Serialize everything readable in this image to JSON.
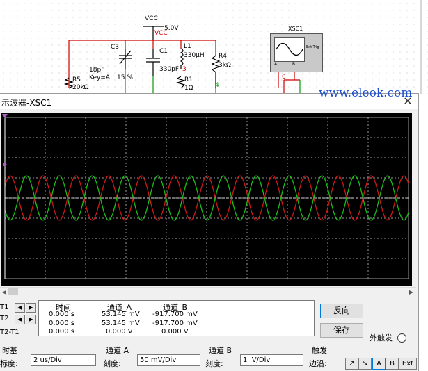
{
  "schematic": {
    "vcc_label": "VCC",
    "vcc_value": "5.0V",
    "vcc_net": "VCC",
    "c3_label": "C3",
    "c3_value": "18pF",
    "c3_key": "Key=A",
    "c3_percent": "15 %",
    "c1_label": "C1",
    "c1_value": "330pF",
    "l1_label": "L1",
    "l1_value": "330µH",
    "node3": "3",
    "r4_label": "R4",
    "r4_value": "3kΩ",
    "r5_label": "R5",
    "r5_value": "20kΩ",
    "r1_label": "R1",
    "r1_value": "1Ω",
    "node4": "4",
    "xsc_label": "XSC1",
    "ext_trig": "Ext Trig",
    "pin_a": "A",
    "pin_b": "B",
    "node0": "0"
  },
  "window": {
    "title": "示波器-XSC1",
    "close_glyph": "✕"
  },
  "cursors": {
    "t1": "T1",
    "t2": "T2",
    "t2t1": "T2-T1",
    "left_arrow": "◀",
    "right_arrow": "▶"
  },
  "readout": {
    "headers": [
      "时间",
      "通道_A",
      "通道_B"
    ],
    "rows": [
      [
        "0.000 s",
        "53.145 mV",
        "-917.700 mV"
      ],
      [
        "0.000 s",
        "53.145 mV",
        "-917.700 mV"
      ],
      [
        "0.000 s",
        "0.000 V",
        "0.000 V"
      ]
    ]
  },
  "buttons": {
    "reverse": "反向",
    "save": "保存",
    "ext_trigger": "外触发"
  },
  "timebase": {
    "section": "时基",
    "scale_label": "标度:",
    "scale_value": "2 us/Div"
  },
  "channel_a": {
    "section": "通道 A",
    "scale_label": "刻度:",
    "scale_value": "50 mV/Div"
  },
  "channel_b": {
    "section": "通道 B",
    "scale_label": "刻度:",
    "scale_value": "1  V/Div"
  },
  "trigger": {
    "section": "触发",
    "edge_label": "边沿:",
    "buttons": [
      "↗",
      "↘",
      "A",
      "B",
      "Ext"
    ]
  },
  "watermark": "www.eleok.com",
  "scope": {
    "grid_cols": 10,
    "grid_rows": 8,
    "red_cycles": 12.3,
    "green_cycles": 12.3,
    "red_amp_div": 1.1,
    "green_amp_div": 1.1,
    "red_phase": 0.55,
    "green_phase": 3.7
  },
  "colors": {
    "trace_a": "#d01818",
    "trace_b": "#18c018",
    "screen_bg": "#000000",
    "grid": "#9a9a9a",
    "accent": "#0078d7"
  }
}
